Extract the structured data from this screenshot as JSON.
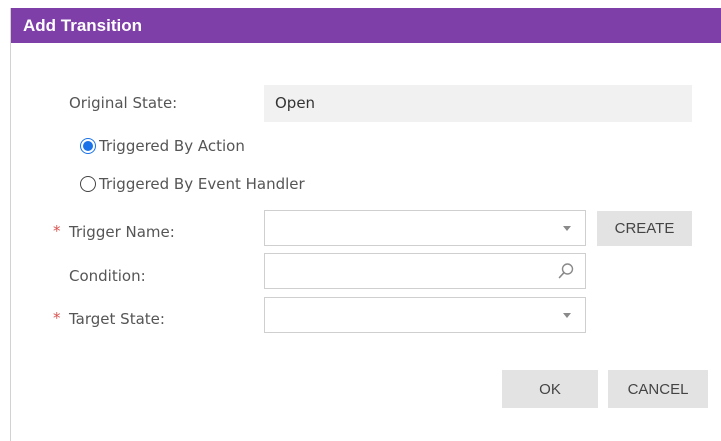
{
  "dialog": {
    "title": "Add Transition"
  },
  "form": {
    "original_state_label": "Original State:",
    "original_state_value": "Open",
    "radio_action_label": "Triggered By Action",
    "radio_event_label": "Triggered By Event Handler",
    "selected_trigger_mode": "Triggered By Action",
    "required_marker": "*",
    "trigger_name_label": "Trigger Name:",
    "trigger_name_value": "",
    "condition_label": "Condition:",
    "condition_value": "",
    "target_state_label": "Target State:",
    "target_state_value": ""
  },
  "buttons": {
    "create_label": "CREATE",
    "ok_label": "OK",
    "cancel_label": "CANCEL"
  },
  "icons": {
    "dropdown": "chevron-down-icon",
    "search": "magnifier-icon"
  },
  "colors": {
    "title_bar": "#7f3fa8",
    "radio_selected": "#1a73e8",
    "required": "#d9534f",
    "button_bg": "#e3e3e3"
  }
}
